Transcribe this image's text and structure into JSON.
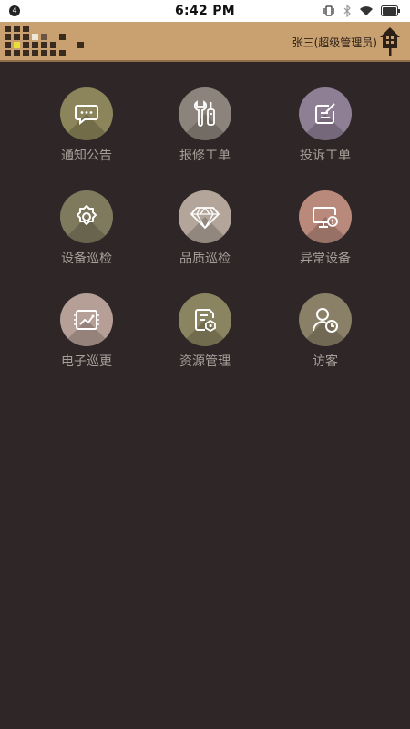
{
  "status_bar": {
    "notification_count": "4",
    "time": "6:42 PM"
  },
  "header": {
    "user_label": "张三(超级管理员)"
  },
  "menu": {
    "items": [
      {
        "label": "通知公告",
        "icon": "message-icon",
        "color": "#8c845a"
      },
      {
        "label": "报修工单",
        "icon": "repair-tools-icon",
        "color": "#8c847c"
      },
      {
        "label": "投诉工单",
        "icon": "complaint-edit-icon",
        "color": "#8f7f95"
      },
      {
        "label": "设备巡检",
        "icon": "gear-icon",
        "color": "#7f7a5e"
      },
      {
        "label": "品质巡检",
        "icon": "diamond-icon",
        "color": "#b3a59a"
      },
      {
        "label": "异常设备",
        "icon": "monitor-alert-icon",
        "color": "#b98a7c"
      },
      {
        "label": "电子巡更",
        "icon": "patrol-chart-icon",
        "color": "#b59f97"
      },
      {
        "label": "资源管理",
        "icon": "resource-doc-icon",
        "color": "#8b8460"
      },
      {
        "label": "访客",
        "icon": "visitor-clock-icon",
        "color": "#8a8067"
      }
    ]
  }
}
